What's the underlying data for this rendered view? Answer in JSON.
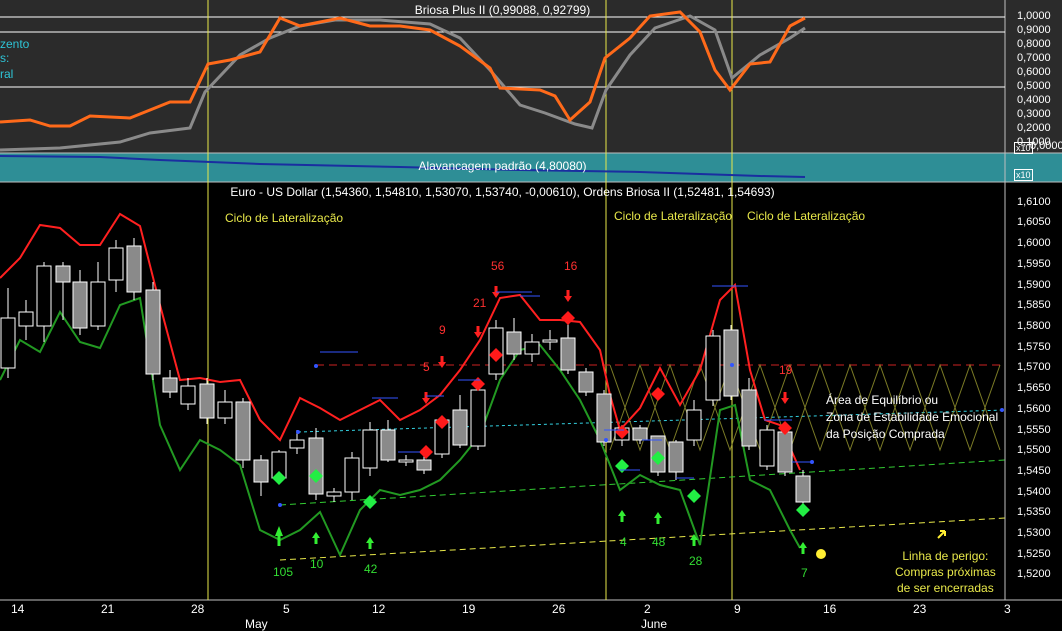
{
  "top_panel": {
    "title": "Briosa Plus II (0,99088, 0,92799)",
    "legend": [
      "zento",
      "s:",
      "ral"
    ],
    "y_labels": [
      "1,0000",
      "0,9000",
      "0,8000",
      "0,7000",
      "0,6000",
      "0,5000",
      "0,4000",
      "0,3000",
      "0,2000",
      "0,1000",
      "0,0000"
    ],
    "x10_badge": "x10",
    "colors": {
      "orange": "#ff6a1a",
      "gray": "#8a8a8a"
    }
  },
  "alav_panel": {
    "title": "Alavancagem padrão (4,80080)",
    "x10_badge": "x10"
  },
  "main_panel": {
    "title": "Euro - US Dollar (1,54360, 1,54810, 1,53070, 1,53740, -0,00610), Ordens Briosa II (1,52481, 1,54693)",
    "y_labels": [
      "1,6100",
      "1,6050",
      "1,6000",
      "1,5950",
      "1,5900",
      "1,5850",
      "1,5800",
      "1,5750",
      "1,5700",
      "1,5650",
      "1,5600",
      "1,5550",
      "1,5500",
      "1,5450",
      "1,5400",
      "1,5350",
      "1,5300",
      "1,5250",
      "1,5200"
    ],
    "cycle_labels": [
      "Ciclo de Lateralização",
      "Ciclo de Lateralização",
      "Ciclo de Lateralização"
    ],
    "red_labels": [
      "56",
      "16",
      "21",
      "9",
      "5",
      "19"
    ],
    "green_labels": [
      "105",
      "10",
      "42",
      "4",
      "48",
      "28",
      "7"
    ],
    "area_note": [
      "Área de Equilíbrio ou",
      "Zona de Estabilidade Emocional",
      "da Posição Comprada"
    ],
    "danger_note": [
      "Linha de perigo:",
      "Compras próximas",
      "de ser encerradas"
    ],
    "colors": {
      "red_line": "#ff2020",
      "green_line": "#229922",
      "cyan": "#33d0e0",
      "yellow": "#e8e84a"
    }
  },
  "x_axis": {
    "days": [
      "14",
      "21",
      "28",
      "5",
      "12",
      "19",
      "26",
      "2",
      "9",
      "16",
      "23",
      "3"
    ],
    "months": [
      "May",
      "June"
    ]
  }
}
